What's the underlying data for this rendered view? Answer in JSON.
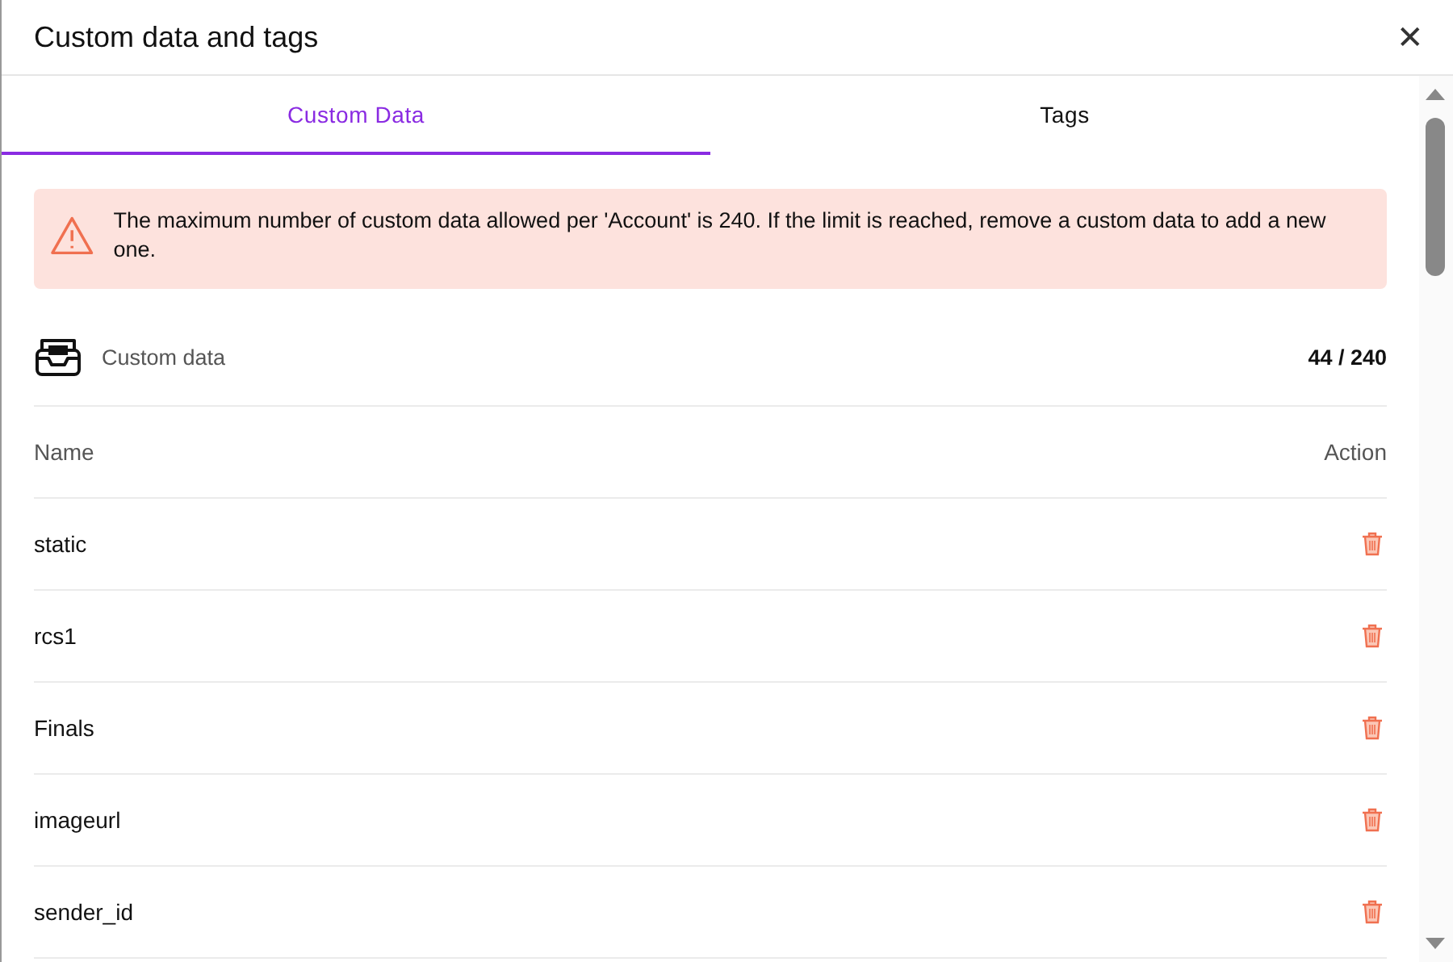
{
  "dialog": {
    "title": "Custom data and tags",
    "close": "✕"
  },
  "tabs": [
    {
      "label": "Custom Data",
      "selected": true
    },
    {
      "label": "Tags",
      "selected": false
    }
  ],
  "alert": {
    "message": "The maximum number of custom data allowed per 'Account' is 240. If the limit is reached, remove a custom data to add a new one."
  },
  "summary": {
    "label": "Custom data",
    "count": "44 / 240"
  },
  "table": {
    "columns": [
      "Name",
      "Action"
    ],
    "rows": [
      {
        "name": "static"
      },
      {
        "name": "rcs1"
      },
      {
        "name": "Finals"
      },
      {
        "name": "imageurl"
      },
      {
        "name": "sender_id"
      }
    ]
  }
}
